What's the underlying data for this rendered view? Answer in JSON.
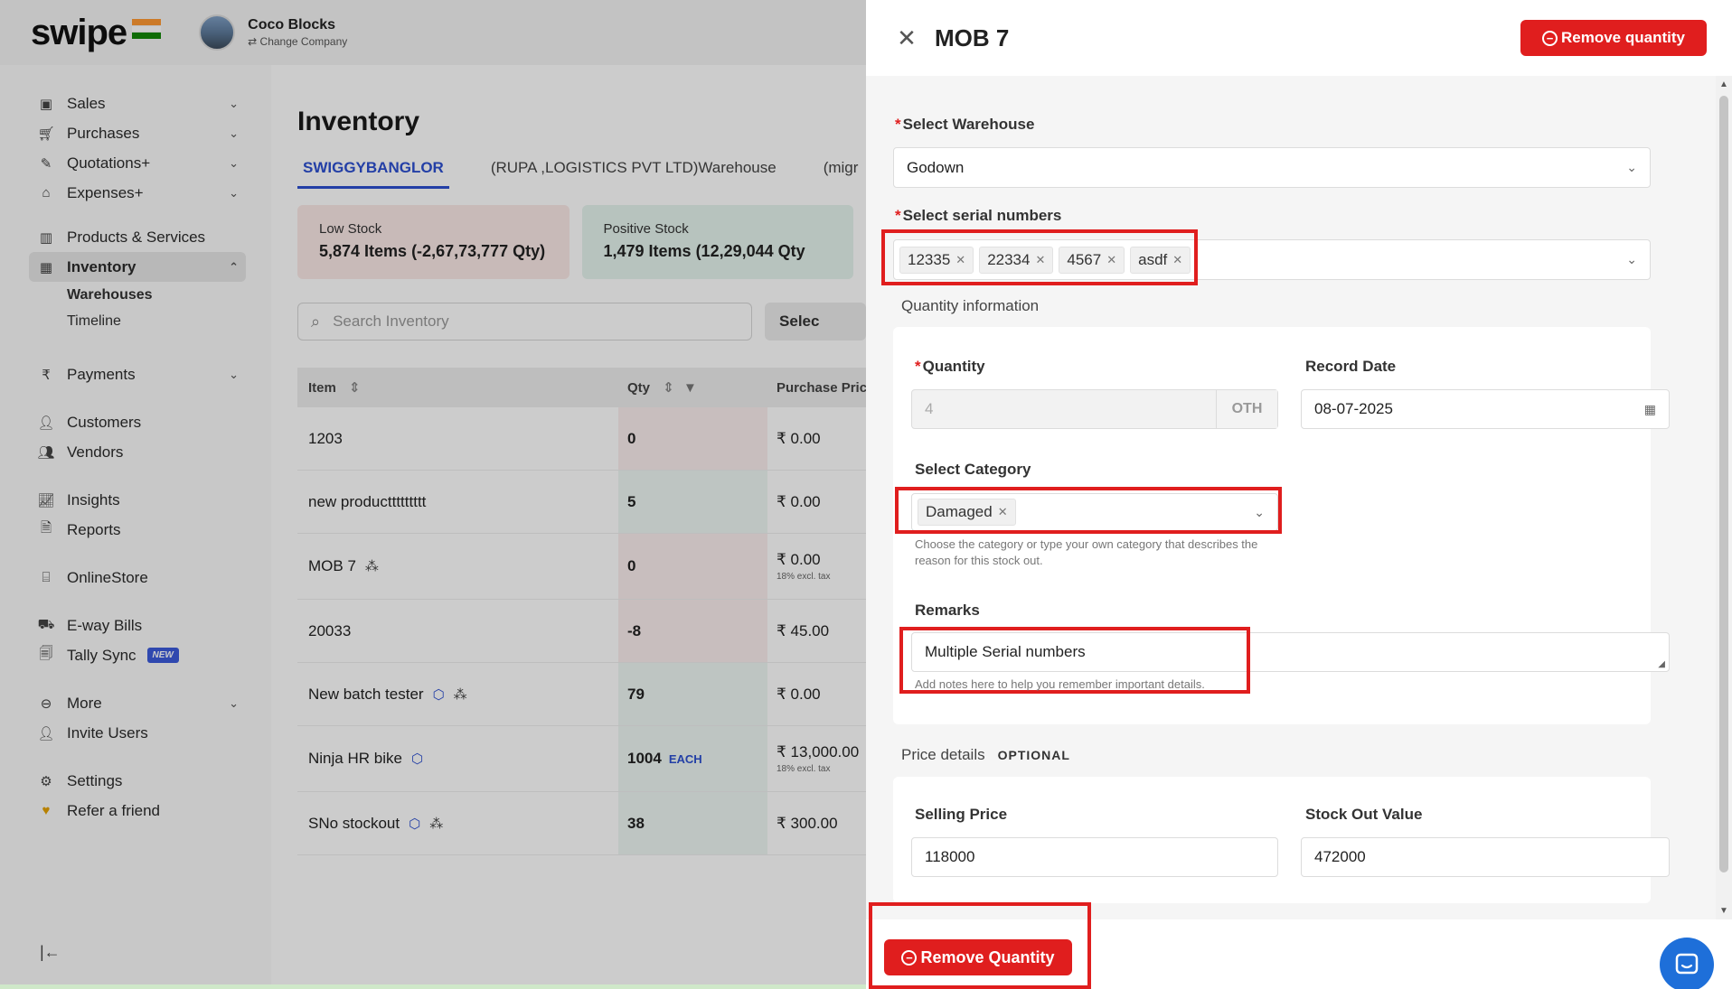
{
  "app": {
    "logo": "swipe",
    "company_name": "Coco Blocks",
    "change_company": "Change Company"
  },
  "sidebar": {
    "items": [
      {
        "label": "Sales"
      },
      {
        "label": "Purchases"
      },
      {
        "label": "Quotations+"
      },
      {
        "label": "Expenses+"
      },
      {
        "label": "Products & Services"
      },
      {
        "label": "Inventory"
      },
      {
        "label": "Warehouses"
      },
      {
        "label": "Timeline"
      },
      {
        "label": "Payments"
      },
      {
        "label": "Customers"
      },
      {
        "label": "Vendors"
      },
      {
        "label": "Insights"
      },
      {
        "label": "Reports"
      },
      {
        "label": "OnlineStore"
      },
      {
        "label": "E-way Bills"
      },
      {
        "label": "Tally Sync"
      },
      {
        "label": "More"
      },
      {
        "label": "Invite Users"
      },
      {
        "label": "Settings"
      },
      {
        "label": "Refer a friend"
      }
    ],
    "new_badge": "NEW"
  },
  "inventory": {
    "title": "Inventory",
    "tabs": [
      "SWIGGYBANGLOR",
      "(RUPA ,LOGISTICS PVT LTD)Warehouse",
      "(migr"
    ],
    "cards": [
      {
        "label": "Low Stock",
        "value": "5,874 Items (-2,67,73,777 Qty)"
      },
      {
        "label": "Positive Stock",
        "value": "1,479 Items (12,29,044 Qty"
      }
    ],
    "search_placeholder": "Search Inventory",
    "select_label": "Selec",
    "columns": {
      "item": "Item",
      "qty": "Qty",
      "price": "Purchase Pric"
    },
    "rows": [
      {
        "item": "1203",
        "qty": "0",
        "price": "₹ 0.00",
        "tax": "",
        "unit": ""
      },
      {
        "item": "new producttttttttt",
        "qty": "5",
        "price": "₹ 0.00",
        "tax": "",
        "unit": ""
      },
      {
        "item": "MOB 7",
        "qty": "0",
        "price": "₹ 0.00",
        "tax": "18% excl. tax",
        "unit": ""
      },
      {
        "item": "20033",
        "qty": "-8",
        "price": "₹ 45.00",
        "tax": "",
        "unit": ""
      },
      {
        "item": "New batch tester",
        "qty": "79",
        "price": "₹ 0.00",
        "tax": "",
        "unit": ""
      },
      {
        "item": "Ninja HR bike",
        "qty": "1004",
        "price": "₹ 13,000.00",
        "tax": "18% excl. tax",
        "unit": "EACH"
      },
      {
        "item": "SNo stockout",
        "qty": "38",
        "price": "₹ 300.00",
        "tax": "",
        "unit": ""
      }
    ]
  },
  "drawer": {
    "title": "MOB 7",
    "header_button": "Remove quantity",
    "warehouse_label": "Select Warehouse",
    "warehouse_value": "Godown",
    "serials_label": "Select serial numbers",
    "serials": [
      "12335",
      "22334",
      "4567",
      "asdf"
    ],
    "quantity_section": "Quantity information",
    "quantity_label": "Quantity",
    "quantity_value": "4",
    "quantity_unit": "OTH",
    "record_date_label": "Record Date",
    "record_date_value": "08-07-2025",
    "category_label": "Select Category",
    "category_tag": "Damaged",
    "category_hint": "Choose the category or type your own category that describes the reason for this stock out.",
    "remarks_label": "Remarks",
    "remarks_value": "Multiple Serial numbers",
    "remarks_hint": "Add notes here to help you remember important details.",
    "price_section": "Price details",
    "price_optional": "OPTIONAL",
    "selling_price_label": "Selling Price",
    "selling_price_value": "118000",
    "stock_out_label": "Stock Out Value",
    "stock_out_value": "472000",
    "footer_button": "Remove Quantity"
  },
  "colors": {
    "accent": "#2c4fd0",
    "danger": "#e01e1e",
    "chat": "#1e6fd9"
  }
}
